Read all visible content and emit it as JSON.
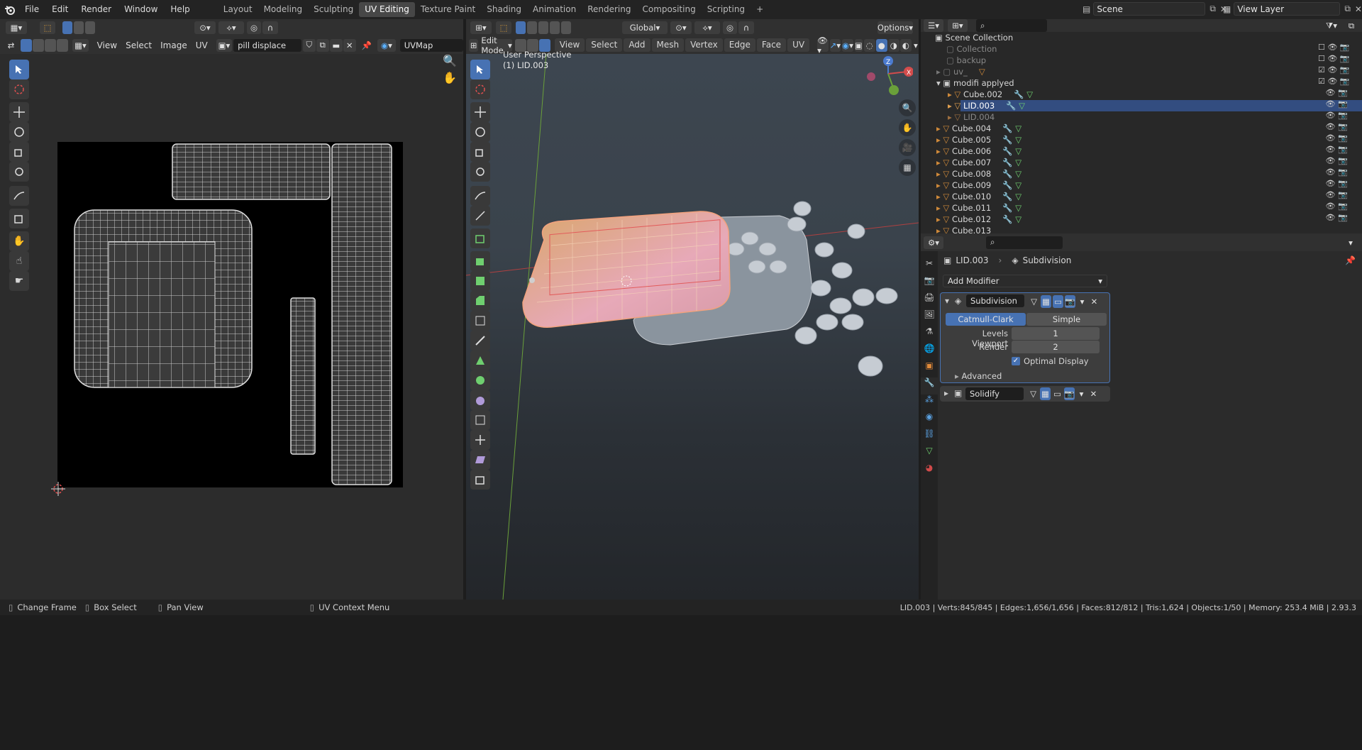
{
  "topbar": {
    "menus": [
      "File",
      "Edit",
      "Render",
      "Window",
      "Help"
    ],
    "workspaces": [
      "Layout",
      "Modeling",
      "Sculpting",
      "UV Editing",
      "Texture Paint",
      "Shading",
      "Animation",
      "Rendering",
      "Compositing",
      "Scripting"
    ],
    "active_workspace": "UV Editing",
    "scene": "Scene",
    "view_layer": "View Layer"
  },
  "uv_editor": {
    "menus": [
      "View",
      "Select",
      "Image",
      "UV"
    ],
    "image_name": "pill displace",
    "uvmap": "UVMap"
  },
  "viewport": {
    "mode": "Edit Mode",
    "menus": [
      "View",
      "Select",
      "Add",
      "Mesh",
      "Vertex",
      "Edge",
      "Face",
      "UV"
    ],
    "orientation": "Global",
    "axes": [
      "X",
      "Y",
      "Z"
    ],
    "options": "Options",
    "overlay_title": "User Perspective",
    "overlay_object": "(1) LID.003"
  },
  "outliner": {
    "root": "Scene Collection",
    "rows": [
      {
        "name": "Collection"
      },
      {
        "name": "backup"
      },
      {
        "name": "uv_"
      },
      {
        "name": "modifi applyed"
      },
      {
        "name": "Cube.002"
      },
      {
        "name": "LID.003"
      },
      {
        "name": "LID.004"
      },
      {
        "name": "Cube.004"
      },
      {
        "name": "Cube.005"
      },
      {
        "name": "Cube.006"
      },
      {
        "name": "Cube.007"
      },
      {
        "name": "Cube.008"
      },
      {
        "name": "Cube.009"
      },
      {
        "name": "Cube.010"
      },
      {
        "name": "Cube.011"
      },
      {
        "name": "Cube.012"
      },
      {
        "name": "Cube.013"
      }
    ]
  },
  "properties": {
    "object": "LID.003",
    "modifier_tab": "Subdivision",
    "add_modifier": "Add Modifier",
    "subdivision": {
      "name": "Subdivision",
      "catmull": "Catmull-Clark",
      "simple": "Simple",
      "levels_label": "Levels Viewport",
      "levels_value": "1",
      "render_label": "Render",
      "render_value": "2",
      "optimal": "Optimal Display",
      "advanced": "Advanced"
    },
    "solidify": {
      "name": "Solidify"
    }
  },
  "statusbar": {
    "change_frame": "Change Frame",
    "box_select": "Box Select",
    "pan_view": "Pan View",
    "uv_context": "UV Context Menu",
    "stats": "LID.003 | Verts:845/845 | Edges:1,656/1,656 | Faces:812/812 | Tris:1,624 | Objects:1/50 | Memory: 253.4 MiB | 2.93.3"
  }
}
